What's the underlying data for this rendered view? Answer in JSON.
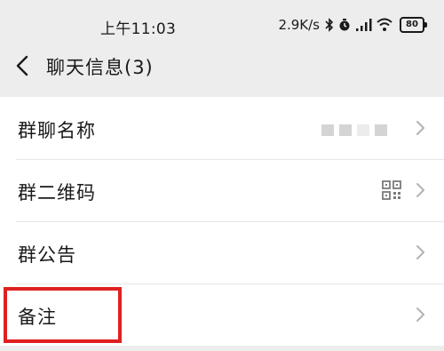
{
  "status_bar": {
    "time": "上午11:03",
    "net_speed": "2.9K/s",
    "battery": "80",
    "icons": [
      "bluetooth-icon",
      "alarm-icon",
      "signal-icon",
      "wifi-icon",
      "battery-icon"
    ]
  },
  "nav": {
    "title": "聊天信息(3)",
    "back_icon": "chevron-left-icon"
  },
  "list": {
    "items": [
      {
        "label": "群聊名称",
        "accessory": "redacted-value"
      },
      {
        "label": "群二维码",
        "accessory": "qr-code-icon"
      },
      {
        "label": "群公告",
        "accessory": "none"
      },
      {
        "label": "备注",
        "accessory": "none",
        "highlighted": true
      }
    ]
  },
  "colors": {
    "background": "#ededed",
    "row": "#ffffff",
    "text": "#1a1a1a",
    "chevron": "#b2b2b2",
    "highlight": "#e02020"
  }
}
